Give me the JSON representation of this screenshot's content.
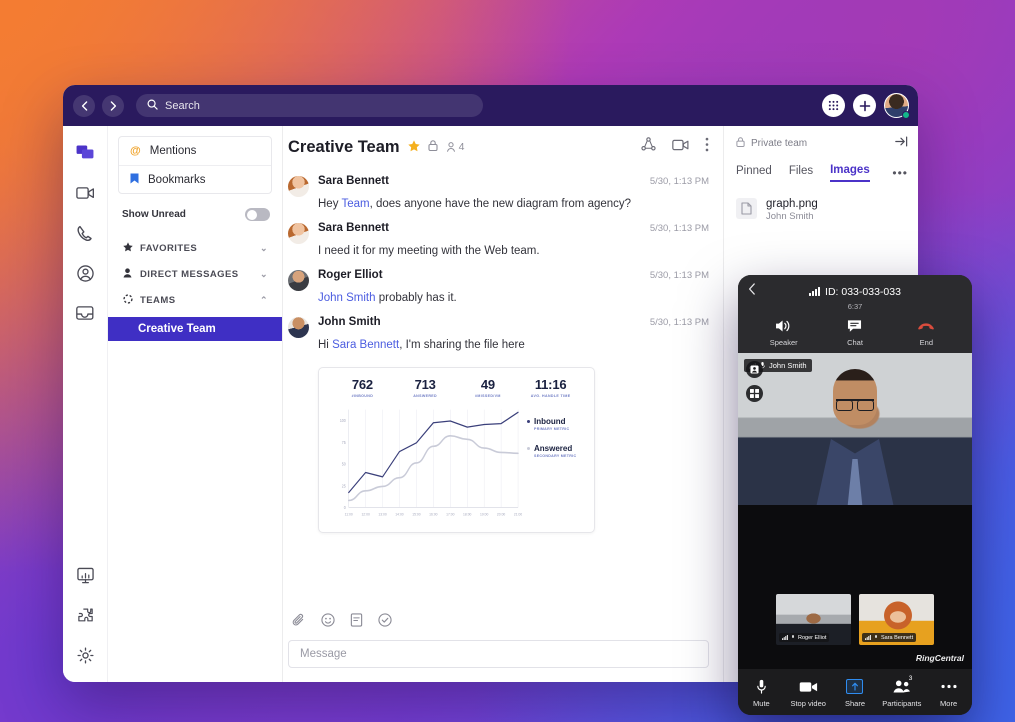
{
  "topbar": {
    "back_icon": "chevron-left-icon",
    "forward_icon": "chevron-right-icon",
    "search_placeholder": "Search",
    "dialpad_icon": "dialpad-icon",
    "add_icon": "plus-icon",
    "avatar_icon": "user-avatar"
  },
  "rail": {
    "items": [
      {
        "name": "messages",
        "icon": "message-bubbles-icon",
        "active": true
      },
      {
        "name": "video",
        "icon": "video-camera-icon",
        "active": false
      },
      {
        "name": "phone",
        "icon": "phone-handset-icon",
        "active": false
      },
      {
        "name": "contacts",
        "icon": "person-circle-icon",
        "active": false
      },
      {
        "name": "fax",
        "icon": "inbox-tray-icon",
        "active": false
      }
    ],
    "bottom": [
      {
        "name": "analytics",
        "icon": "monitor-chart-icon"
      },
      {
        "name": "apps",
        "icon": "puzzle-piece-icon"
      },
      {
        "name": "settings",
        "icon": "gear-icon"
      }
    ]
  },
  "sidebar": {
    "mentions_label": "Mentions",
    "bookmarks_label": "Bookmarks",
    "show_unread_label": "Show Unread",
    "show_unread_on": false,
    "sections": [
      {
        "label": "FAVORITES",
        "icon": "star-icon",
        "expanded": false
      },
      {
        "label": "DIRECT MESSAGES",
        "icon": "person-icon",
        "expanded": false
      },
      {
        "label": "TEAMS",
        "icon": "teams-icon",
        "expanded": true
      }
    ],
    "team_selected": "Creative Team"
  },
  "conversation": {
    "title": "Creative Team",
    "favorited": true,
    "private_icon": "lock-icon",
    "member_count": "4",
    "head_actions": [
      {
        "name": "share-network",
        "icon": "share-network-icon"
      },
      {
        "name": "start-video",
        "icon": "video-camera-icon"
      },
      {
        "name": "more-options",
        "icon": "kebab-menu-icon"
      }
    ],
    "messages": [
      {
        "author": "Sara Bennett",
        "avatar": "av-sara",
        "time": "5/30, 1:13 PM",
        "segments": [
          {
            "text": "Hey ",
            "mention": false
          },
          {
            "text": "Team",
            "mention": true
          },
          {
            "text": ", does anyone have the new diagram from agency?",
            "mention": false
          }
        ]
      },
      {
        "author": "Sara Bennett",
        "avatar": "av-sara",
        "time": "5/30, 1:13 PM",
        "segments": [
          {
            "text": "I need it for my meeting with the Web team.",
            "mention": false
          }
        ]
      },
      {
        "author": "Roger Elliot",
        "avatar": "av-roger",
        "time": "5/30, 1:13 PM",
        "segments": [
          {
            "text": "John Smith",
            "mention": true
          },
          {
            "text": " probably has it.",
            "mention": false
          }
        ]
      },
      {
        "author": "John Smith",
        "avatar": "av-john",
        "time": "5/30, 1:13 PM",
        "segments": [
          {
            "text": "Hi ",
            "mention": false
          },
          {
            "text": "Sara Bennett",
            "mention": true
          },
          {
            "text": ", I'm sharing the file here",
            "mention": false
          }
        ]
      }
    ],
    "compose": {
      "placeholder": "Message",
      "tools": [
        {
          "name": "attach-file",
          "icon": "paperclip-icon"
        },
        {
          "name": "insert-emoji",
          "icon": "smiley-icon"
        },
        {
          "name": "create-note",
          "icon": "note-icon"
        },
        {
          "name": "create-task",
          "icon": "check-circle-icon"
        }
      ]
    }
  },
  "chart_data": {
    "type": "line",
    "title": "",
    "xlabel": "",
    "ylabel": "",
    "ylim": [
      0,
      112
    ],
    "yticks": [
      0,
      25,
      50,
      75,
      100
    ],
    "grid": true,
    "legend_position": "right",
    "kpis": [
      {
        "value": "762",
        "label": "#INBOUND"
      },
      {
        "value": "713",
        "label": "ANSWERED"
      },
      {
        "value": "49",
        "label": "#MISSED/VM"
      },
      {
        "value": "11:16",
        "label": "AVG. HANDLE TIME"
      }
    ],
    "categories": [
      "11:00",
      "12:00",
      "13:00",
      "14:00",
      "15:00",
      "16:00",
      "17:00",
      "18:00",
      "19:00",
      "20:00",
      "21:00"
    ],
    "series": [
      {
        "name": "Inbound",
        "sublabel": "PRIMARY METRIC",
        "color": "#3a3f7a",
        "values": [
          17,
          40,
          35,
          64,
          74,
          97,
          99,
          92,
          95,
          96,
          109
        ]
      },
      {
        "name": "Answered",
        "sublabel": "SECONDARY METRIC",
        "color": "#c9cbd8",
        "values": [
          8,
          19,
          24,
          34,
          51,
          70,
          82,
          78,
          68,
          63,
          62
        ]
      }
    ]
  },
  "right_panel": {
    "privacy_label": "Private team",
    "privacy_icon": "lock-icon",
    "expand_icon": "expand-panel-icon",
    "tabs": [
      {
        "label": "Pinned",
        "active": false
      },
      {
        "label": "Files",
        "active": false
      },
      {
        "label": "Images",
        "active": true
      }
    ],
    "more_icon": "ellipsis-icon",
    "files": [
      {
        "name": "graph.png",
        "owner": "John Smith",
        "icon": "file-icon"
      }
    ]
  },
  "video_call": {
    "back_icon": "chevron-left-icon",
    "signal_icon": "signal-bars-icon",
    "meeting_id": "ID: 033-033-033",
    "timer": "6:37",
    "header_actions": [
      {
        "label": "Speaker",
        "icon": "speaker-icon"
      },
      {
        "label": "Chat",
        "icon": "chat-bubble-icon"
      },
      {
        "label": "End",
        "icon": "end-call-icon"
      }
    ],
    "overlay_buttons": [
      {
        "name": "active-speaker-view",
        "icon": "person-frame-icon"
      },
      {
        "name": "gallery-view",
        "icon": "grid-view-icon"
      }
    ],
    "main_participant": "John Smith",
    "thumbnails": [
      {
        "name": "Roger Elliot",
        "style": "roger"
      },
      {
        "name": "Sara Bennett",
        "style": "sara"
      }
    ],
    "brand": "RingCentral",
    "controls": [
      {
        "label": "Mute",
        "icon": "microphone-icon",
        "badge": ""
      },
      {
        "label": "Stop video",
        "icon": "video-camera-icon",
        "badge": ""
      },
      {
        "label": "Share",
        "icon": "share-screen-icon",
        "badge": ""
      },
      {
        "label": "Participants",
        "icon": "participants-icon",
        "badge": "3"
      },
      {
        "label": "More",
        "icon": "ellipsis-icon",
        "badge": ""
      }
    ]
  }
}
